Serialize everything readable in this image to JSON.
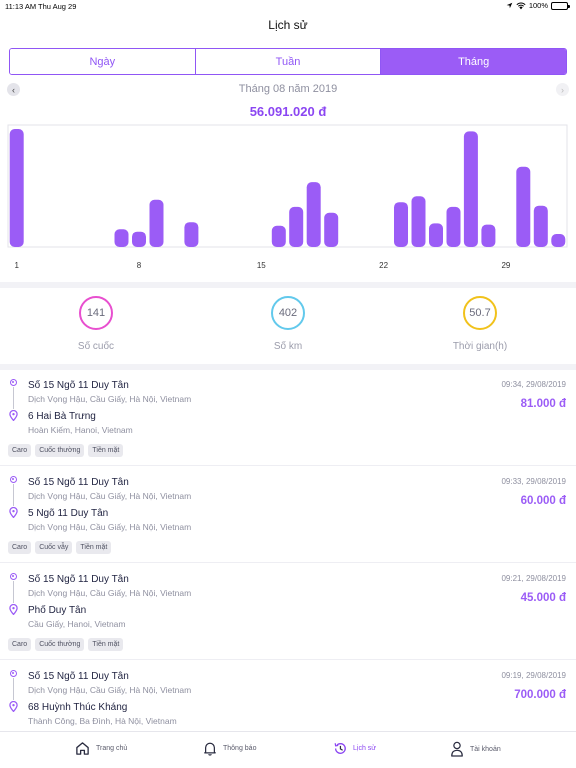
{
  "status_bar": {
    "time": "11:13 AM",
    "date": "Thu Aug 29",
    "battery": "100%"
  },
  "nav": {
    "title": "Lịch sử"
  },
  "segments": [
    "Ngày",
    "Tuần",
    "Tháng"
  ],
  "segment_selected": "Tháng",
  "month": {
    "label": "Tháng 08 năm 2019",
    "total": "56.091.020 đ"
  },
  "chart_data": {
    "type": "bar",
    "x": [
      1,
      2,
      3,
      4,
      5,
      6,
      7,
      8,
      9,
      10,
      11,
      12,
      13,
      14,
      15,
      16,
      17,
      18,
      19,
      20,
      21,
      22,
      23,
      24,
      25,
      26,
      27,
      28,
      29,
      30,
      31
    ],
    "values": [
      100,
      0,
      0,
      0,
      0,
      0,
      15,
      13,
      40,
      0,
      21,
      0,
      0,
      0,
      0,
      18,
      34,
      55,
      29,
      0,
      0,
      0,
      38,
      43,
      20,
      34,
      98,
      19,
      0,
      68,
      35,
      11
    ],
    "tick_labels": [
      "1",
      "8",
      "15",
      "22",
      "29"
    ],
    "tick_days": [
      1,
      8,
      15,
      22,
      29
    ],
    "color": "#9b5cf6",
    "grid": false
  },
  "stats": [
    {
      "value": "141",
      "label": "Số cuốc",
      "color": "#e84fcf"
    },
    {
      "value": "402",
      "label": "Số km",
      "color": "#62c9ec"
    },
    {
      "value": "50.7",
      "label": "Thời gian(h)",
      "color": "#f1c21b"
    }
  ],
  "trips": [
    {
      "from_name": "Số 15 Ngõ 11 Duy Tân",
      "from_addr": "Dịch Vọng Hậu, Cầu Giấy, Hà Nội, Vietnam",
      "to_name": "6 Hai Bà Trưng",
      "to_addr": "Hoàn Kiếm, Hanoi, Vietnam",
      "time": "09:34, 29/08/2019",
      "price": "81.000 đ",
      "tags": [
        "Caro",
        "Cuốc thường",
        "Tiền mặt"
      ]
    },
    {
      "from_name": "Số 15 Ngõ 11 Duy Tân",
      "from_addr": "Dịch Vọng Hậu, Cầu Giấy, Hà Nội, Vietnam",
      "to_name": "5 Ngõ 11 Duy Tân",
      "to_addr": "Dịch Vọng Hậu, Cầu Giấy, Hà Nội, Vietnam",
      "time": "09:33, 29/08/2019",
      "price": "60.000 đ",
      "tags": [
        "Caro",
        "Cuốc vẫy",
        "Tiền mặt"
      ]
    },
    {
      "from_name": "Số 15 Ngõ 11 Duy Tân",
      "from_addr": "Dịch Vọng Hậu, Cầu Giấy, Hà Nội, Vietnam",
      "to_name": "Phố Duy Tân",
      "to_addr": "Cầu Giấy, Hanoi, Vietnam",
      "time": "09:21, 29/08/2019",
      "price": "45.000 đ",
      "tags": [
        "Caro",
        "Cuốc thường",
        "Tiền mặt"
      ]
    },
    {
      "from_name": "Số 15 Ngõ 11 Duy Tân",
      "from_addr": "Dịch Vọng Hậu, Cầu Giấy, Hà Nội, Vietnam",
      "to_name": "68 Huỳnh Thúc Kháng",
      "to_addr": "Thành Công, Ba Đình, Hà Nội, Vietnam",
      "time": "09:19, 29/08/2019",
      "price": "700.000 đ",
      "tags": []
    }
  ],
  "tabbar": {
    "items": [
      {
        "label": "Trang chủ",
        "icon": "home-icon"
      },
      {
        "label": "Thông báo",
        "icon": "bell-icon"
      },
      {
        "label": "Lịch sử",
        "icon": "history-icon"
      },
      {
        "label": "Tài khoản",
        "icon": "user-icon"
      }
    ],
    "active": "Lịch sử"
  }
}
